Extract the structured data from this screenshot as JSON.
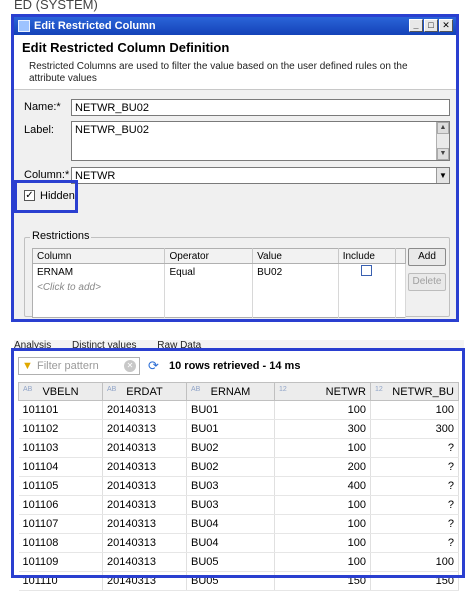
{
  "top_cut_text": "ED (SYSTEM)",
  "dialog": {
    "title": "Edit Restricted Column",
    "heading": "Edit Restricted Column Definition",
    "description": "Restricted Columns are used to filter the value based on the user defined rules on the attribute values",
    "name_label": "Name:*",
    "name_value": "NETWR_BU02",
    "label_label": "Label:",
    "label_value": "NETWR_BU02",
    "column_label": "Column:*",
    "column_value": "NETWR",
    "hidden_label": "Hidden",
    "hidden_checked": true,
    "restrictions": {
      "group_title": "Restrictions",
      "columns": [
        "Column",
        "Operator",
        "Value",
        "Include"
      ],
      "rows": [
        {
          "column": "ERNAM",
          "operator": "Equal",
          "value": "BU02",
          "include": false
        }
      ],
      "click_to_add": "<Click to add>",
      "add_button": "Add",
      "delete_button": "Delete"
    }
  },
  "tabs": [
    "Analysis",
    "Distinct values",
    "Raw Data"
  ],
  "results": {
    "filter_placeholder": "Filter pattern",
    "rows_info": "10 rows retrieved - 14 ms",
    "columns": [
      {
        "type": "AB",
        "name": "VBELN"
      },
      {
        "type": "AB",
        "name": "ERDAT"
      },
      {
        "type": "AB",
        "name": "ERNAM"
      },
      {
        "type": "12",
        "name": "NETWR"
      },
      {
        "type": "12",
        "name": "NETWR_BU"
      }
    ],
    "rows": [
      [
        "101101",
        "20140313",
        "BU01",
        "100",
        "100"
      ],
      [
        "101102",
        "20140313",
        "BU01",
        "300",
        "300"
      ],
      [
        "101103",
        "20140313",
        "BU02",
        "100",
        "?"
      ],
      [
        "101104",
        "20140313",
        "BU02",
        "200",
        "?"
      ],
      [
        "101105",
        "20140313",
        "BU03",
        "400",
        "?"
      ],
      [
        "101106",
        "20140313",
        "BU03",
        "100",
        "?"
      ],
      [
        "101107",
        "20140313",
        "BU04",
        "100",
        "?"
      ],
      [
        "101108",
        "20140313",
        "BU04",
        "100",
        "?"
      ],
      [
        "101109",
        "20140313",
        "BU05",
        "100",
        "100"
      ],
      [
        "101110",
        "20140313",
        "BU05",
        "150",
        "150"
      ]
    ]
  },
  "colors": {
    "highlight_frame": "#2a3fd0",
    "titlebar": "#1f54c8"
  }
}
